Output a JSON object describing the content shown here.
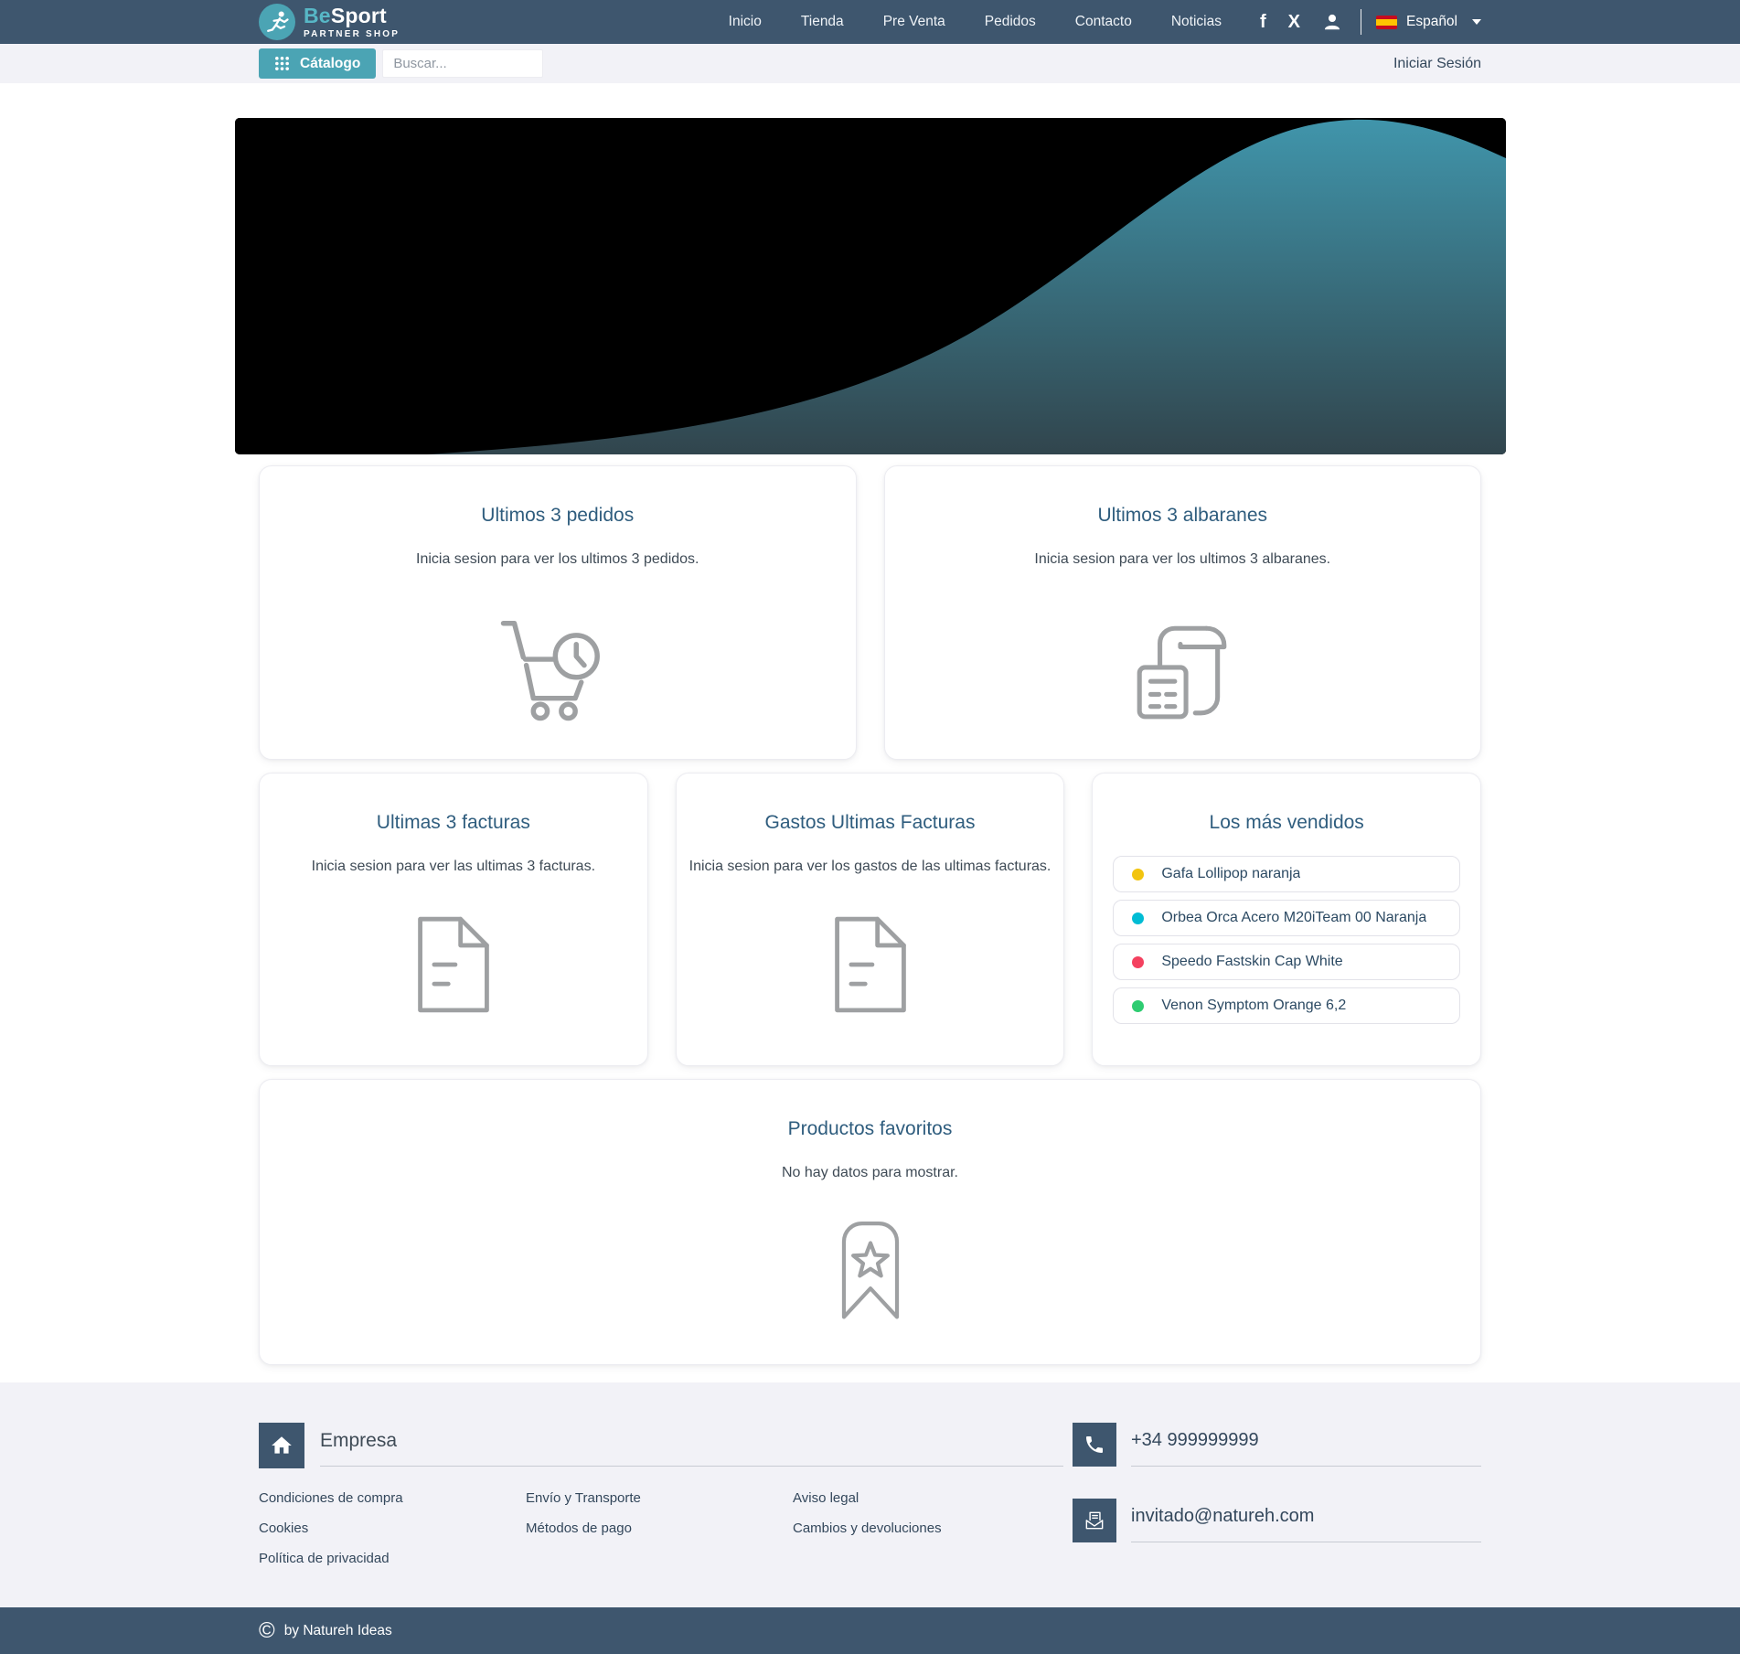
{
  "navbar": {
    "brand": {
      "name_primary": "Be",
      "name_secondary": "Sport",
      "subtitle": "PARTNER SHOP"
    },
    "links": [
      {
        "label": "Inicio"
      },
      {
        "label": "Tienda"
      },
      {
        "label": "Pre Venta"
      },
      {
        "label": "Pedidos"
      },
      {
        "label": "Contacto"
      },
      {
        "label": "Noticias"
      }
    ],
    "language": {
      "label": "Español"
    }
  },
  "icons": {
    "facebook_glyph": "f",
    "x_glyph": "X",
    "copyright_glyph": "©"
  },
  "subheader": {
    "catalog_label": "Cátalogo",
    "search_placeholder": "Buscar...",
    "login_label": "Iniciar Sesión"
  },
  "cards": {
    "pedidos": {
      "title": "Ultimos 3 pedidos",
      "body": "Inicia sesion para ver los ultimos 3 pedidos."
    },
    "albaranes": {
      "title": "Ultimos 3 albaranes",
      "body": "Inicia sesion para ver los ultimos 3 albaranes."
    },
    "facturas": {
      "title": "Ultimas 3 facturas",
      "body": "Inicia sesion para ver las ultimas 3 facturas."
    },
    "gastos": {
      "title": "Gastos Ultimas Facturas",
      "body": "Inicia sesion para ver los gastos de las ultimas facturas."
    },
    "vendidos": {
      "title": "Los más vendidos",
      "items": [
        {
          "label": "Gafa Lollipop naranja",
          "dot_color": "#F2C40F"
        },
        {
          "label": "Orbea Orca Acero M20iTeam 00 Naranja",
          "dot_color": "#00BCD4"
        },
        {
          "label": "Speedo Fastskin Cap White",
          "dot_color": "#F4415F"
        },
        {
          "label": "Venon Symptom Orange 6,2",
          "dot_color": "#2ECC71"
        }
      ]
    },
    "favoritos": {
      "title": "Productos favoritos",
      "body": "No hay datos para mostrar."
    }
  },
  "footer": {
    "company_title": "Empresa",
    "link_columns": [
      [
        "Condiciones de compra",
        "Cookies",
        "Política de privacidad"
      ],
      [
        "Envío y Transporte",
        "Métodos de pago"
      ],
      [
        "Aviso legal",
        "Cambios y devoluciones"
      ]
    ],
    "phone": "+34 999999999",
    "email": "invitado@natureh.com"
  },
  "bottombar": {
    "copyright": "by Natureh Ideas"
  },
  "colors": {
    "navbar_bg": "#3E566E",
    "accent_teal": "#4BA4B4",
    "hero_bg": "#000000",
    "hero_teal_top": "#4095AB",
    "hero_teal_bottom": "#31454D"
  }
}
